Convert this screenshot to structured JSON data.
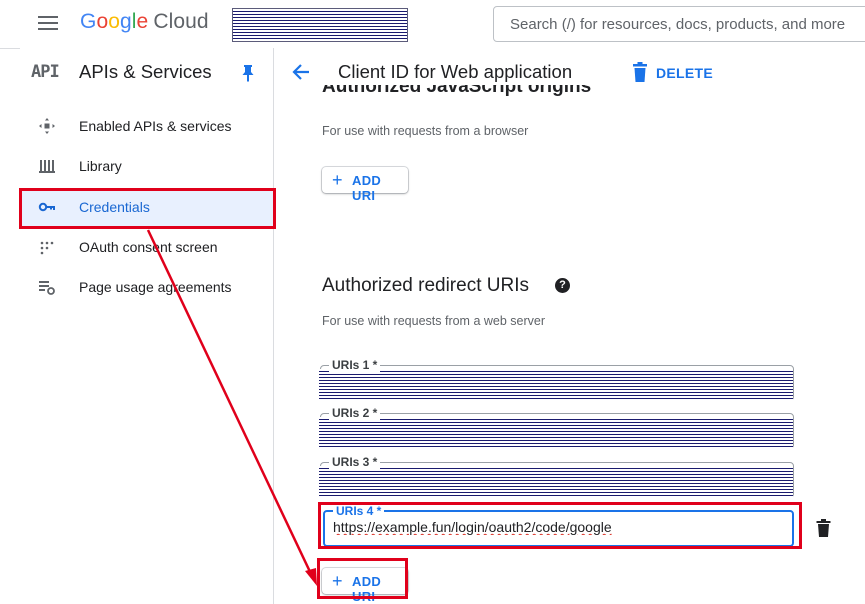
{
  "topbar": {
    "logo_google": "Google",
    "logo_cloud": "Cloud",
    "search_placeholder": "Search (/) for resources, docs, products, and more"
  },
  "sidebar": {
    "badge": "API",
    "title": "APIs & Services",
    "items": [
      {
        "label": "Enabled APIs & services",
        "icon": "apis-icon"
      },
      {
        "label": "Library",
        "icon": "library-icon"
      },
      {
        "label": "Credentials",
        "icon": "key-icon",
        "active": true
      },
      {
        "label": "OAuth consent screen",
        "icon": "oauth-icon"
      },
      {
        "label": "Page usage agreements",
        "icon": "agreements-icon"
      }
    ]
  },
  "header": {
    "title": "Client ID for Web application",
    "delete_label": "DELETE"
  },
  "js_origins": {
    "title_partial": "Authorized JavaScript origins",
    "hint": "For use with requests from a browser",
    "add_label": "ADD URI"
  },
  "redirect_uris": {
    "title": "Authorized redirect URIs",
    "help": "?",
    "hint": "For use with requests from a web server",
    "fields": [
      {
        "label": "URIs 1 *"
      },
      {
        "label": "URIs 2 *"
      },
      {
        "label": "URIs 3 *"
      },
      {
        "label": "URIs 4 *",
        "value": "https://example.fun/login/oauth2/code/google"
      }
    ],
    "add_label": "ADD URI"
  },
  "colors": {
    "accent": "#1a73e8",
    "annotation": "#e0001b",
    "active_bg": "#e8f0fe"
  }
}
